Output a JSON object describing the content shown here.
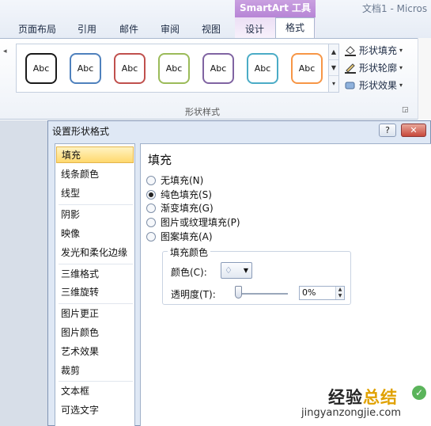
{
  "window": {
    "doc_title": "文档1 - Micros"
  },
  "ribbon": {
    "contextual_header": "SmartArt 工具",
    "tabs": [
      {
        "label": "页面布局"
      },
      {
        "label": "引用"
      },
      {
        "label": "邮件"
      },
      {
        "label": "审阅"
      },
      {
        "label": "视图"
      },
      {
        "label": "设计"
      },
      {
        "label": "格式",
        "active": true
      }
    ],
    "shape_styles": {
      "swatch_text": "Abc",
      "swatch_colors": [
        "#1a1a1a",
        "#4f81bd",
        "#c0504d",
        "#9bbb59",
        "#8064a2",
        "#4bacc6",
        "#f79646"
      ],
      "group_label": "形状样式",
      "commands": [
        {
          "label": "形状填充",
          "icon": "paint-bucket-icon"
        },
        {
          "label": "形状轮廓",
          "icon": "pen-outline-icon"
        },
        {
          "label": "形状效果",
          "icon": "shape-effects-icon"
        }
      ]
    }
  },
  "dialog": {
    "title": "设置形状格式",
    "help_label": "?",
    "close_label": "✕",
    "nav": [
      {
        "label": "填充",
        "selected": true
      },
      {
        "label": "线条颜色"
      },
      {
        "label": "线型"
      },
      {
        "label": "阴影"
      },
      {
        "label": "映像"
      },
      {
        "label": "发光和柔化边缘"
      },
      {
        "label": "三维格式"
      },
      {
        "label": "三维旋转"
      },
      {
        "label": "图片更正"
      },
      {
        "label": "图片颜色"
      },
      {
        "label": "艺术效果"
      },
      {
        "label": "裁剪"
      },
      {
        "label": "文本框"
      },
      {
        "label": "可选文字"
      }
    ],
    "pane": {
      "title": "填充",
      "options": [
        {
          "label": "无填充(N)",
          "checked": false
        },
        {
          "label": "纯色填充(S)",
          "checked": true
        },
        {
          "label": "渐变填充(G)",
          "checked": false
        },
        {
          "label": "图片或纹理填充(P)",
          "checked": false
        },
        {
          "label": "图案填充(A)",
          "checked": false
        }
      ],
      "fill_color": {
        "group_title": "填充颜色",
        "color_label": "颜色(C):",
        "transparency_label": "透明度(T):",
        "transparency_value": "0%",
        "transparency_level": 0
      }
    }
  },
  "watermark": {
    "brand_part1": "经验",
    "brand_part2": "总结",
    "url": "jingyanzongjie.com"
  }
}
